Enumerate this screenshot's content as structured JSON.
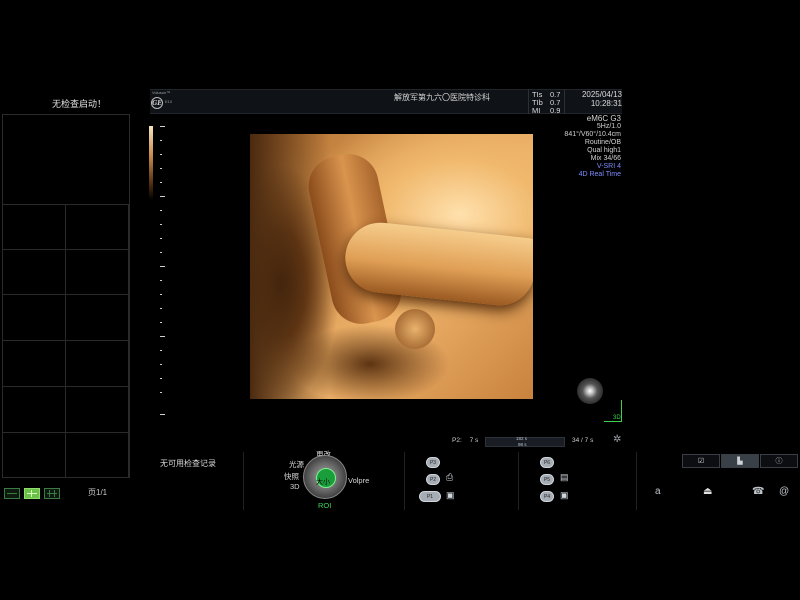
{
  "left_panel": {
    "notice": "无检查启动！",
    "page_label": "页1/1"
  },
  "header": {
    "logo_line": "Voluson™",
    "ge_mark": "GE",
    "ge_sub": "E10",
    "hospital": "解放军第九六〇医院特诊科",
    "tis_label": "TIs",
    "tis_value": "0.7",
    "tib_label": "TIb",
    "tib_value": "0.7",
    "mi_label": "MI",
    "mi_value": "0.9",
    "date": "2025/04/13",
    "time": "10:28:31"
  },
  "params": [
    "5Hz/1.0",
    "841°/V60°/10.4cm",
    "Routine/OB",
    "Qual high1",
    "Mix 34/66"
  ],
  "params_hl": [
    "V-SRI 4",
    "4D Real Time"
  ],
  "probe": "eM6C G3",
  "orientation": {
    "label": "3D"
  },
  "cine": {
    "p2_label": "P2:",
    "p2_value": "7 s",
    "bar_top": "182 s",
    "bar_bottom": "98 s",
    "right": "34 / 7 s"
  },
  "bottom": {
    "no_records": "无可用检查记录",
    "knob": {
      "top": "更改",
      "left_top": "光源",
      "left_mid": "快照",
      "left_bot": "3D",
      "center": "大小",
      "right": "Volpre",
      "bottom": "ROI"
    },
    "fkeys_left": [
      "P3",
      "P2",
      "P1"
    ],
    "fkeys_right": [
      "P6",
      "P5",
      "P4"
    ]
  },
  "right_tabs": [
    "☑",
    "▙",
    "ⓘ"
  ],
  "sys_icons": [
    "a",
    "⏏",
    "☎",
    "@"
  ],
  "colors": {
    "render_light": "#ffe0ac",
    "render_dark": "#3a1d08",
    "green": "#43d65a",
    "highlight": "#7f8cff"
  }
}
